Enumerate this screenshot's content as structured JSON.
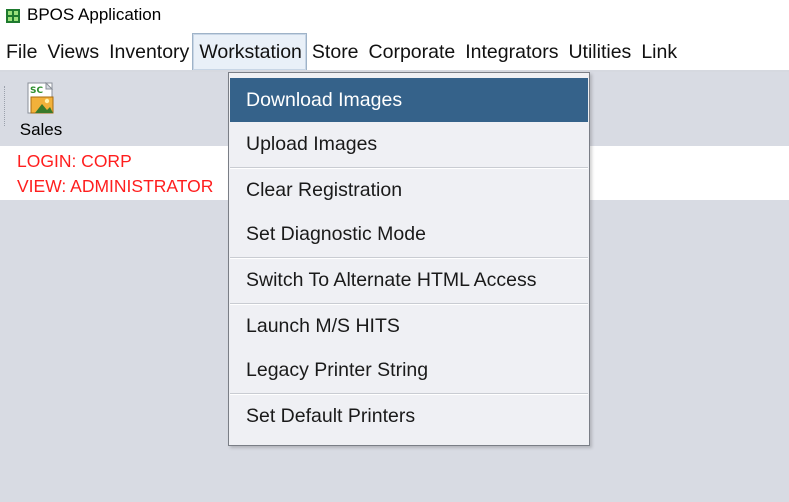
{
  "window": {
    "title": "BPOS Application"
  },
  "menubar": {
    "items": [
      "File",
      "Views",
      "Inventory",
      "Workstation",
      "Store",
      "Corporate",
      "Integrators",
      "Utilities",
      "Link"
    ],
    "active": "Workstation"
  },
  "toolbar": {
    "sales_label": "Sales",
    "sales_icon_text": "SC"
  },
  "status": {
    "login": "LOGIN: CORP",
    "view": "VIEW: ADMINISTRATOR"
  },
  "dropdown": {
    "items": [
      "Download Images",
      "Upload Images",
      "Clear Registration",
      "Set Diagnostic Mode",
      "Switch To Alternate HTML Access",
      "Launch M/S HITS",
      "Legacy Printer String",
      "Set Default Printers"
    ],
    "highlighted": "Download Images"
  },
  "colors": {
    "status_text": "#ff1e1e",
    "highlight_bg": "#35628a",
    "toolbar_bg": "#d8dbe3"
  }
}
